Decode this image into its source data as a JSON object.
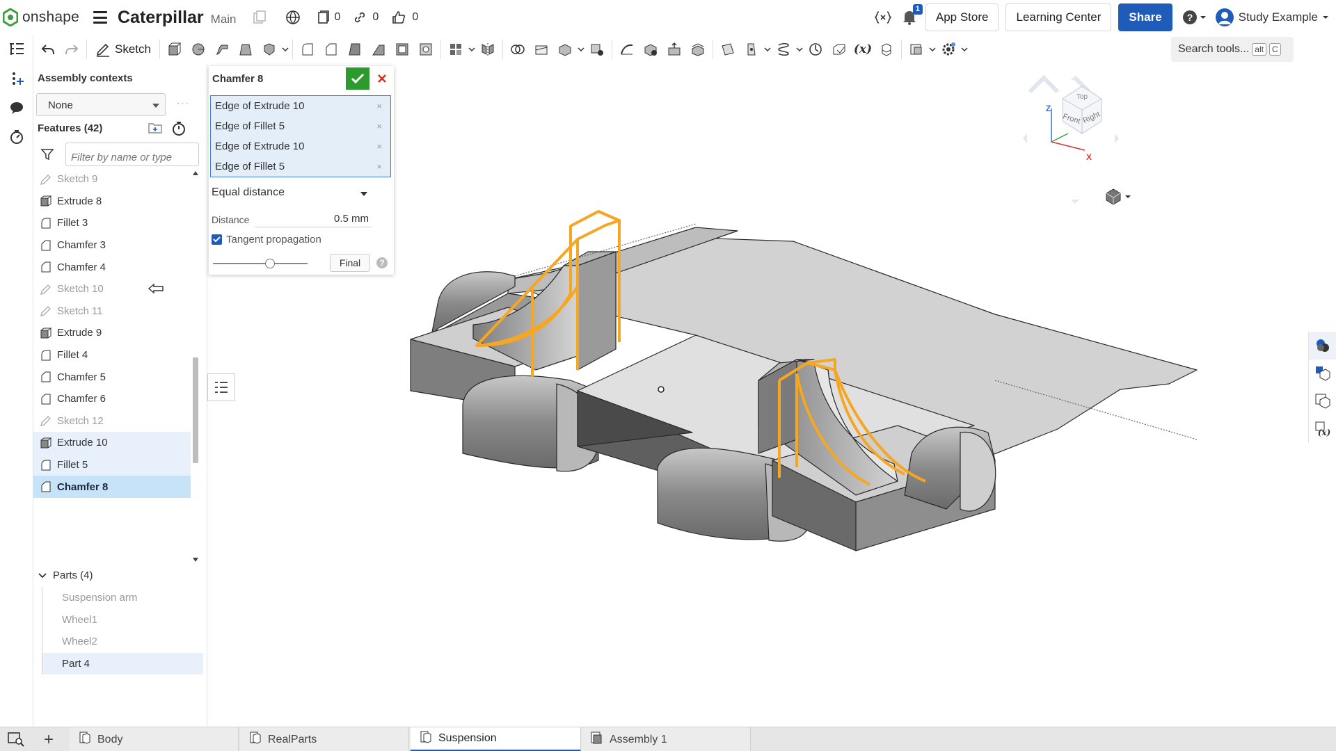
{
  "app": {
    "logo_text": "onshape",
    "doc_title": "Caterpillar",
    "branch": "Main",
    "versions_count": "0",
    "links_count": "0",
    "likes_count": "0",
    "notifications_count": "1",
    "app_store_label": "App Store",
    "learning_center_label": "Learning Center",
    "share_label": "Share",
    "user_name": "Study Example",
    "brand_color": "#1f5bb8",
    "accent_color": "#f5a623"
  },
  "toolbar": {
    "sketch_label": "Sketch",
    "search_placeholder": "Search tools...",
    "search_shortcut_1": "alt",
    "search_shortcut_2": "C"
  },
  "feature_panel": {
    "assembly_contexts_label": "Assembly contexts",
    "assembly_context_value": "None",
    "more_label": "···",
    "features_label": "Features (42)",
    "filter_placeholder": "Filter by name or type",
    "features": [
      {
        "name": "Sketch 9",
        "type": "sketch",
        "state": "muted"
      },
      {
        "name": "Extrude 8",
        "type": "extrude",
        "state": "normal"
      },
      {
        "name": "Fillet 3",
        "type": "fillet",
        "state": "normal"
      },
      {
        "name": "Chamfer 3",
        "type": "chamfer",
        "state": "normal"
      },
      {
        "name": "Chamfer 4",
        "type": "chamfer",
        "state": "normal"
      },
      {
        "name": "Sketch 10",
        "type": "sketch",
        "state": "muted"
      },
      {
        "name": "Sketch 11",
        "type": "sketch",
        "state": "muted"
      },
      {
        "name": "Extrude 9",
        "type": "extrude",
        "state": "normal"
      },
      {
        "name": "Fillet 4",
        "type": "fillet",
        "state": "normal"
      },
      {
        "name": "Chamfer 5",
        "type": "chamfer",
        "state": "normal"
      },
      {
        "name": "Chamfer 6",
        "type": "chamfer",
        "state": "normal"
      },
      {
        "name": "Sketch 12",
        "type": "sketch",
        "state": "muted"
      },
      {
        "name": "Extrude 10",
        "type": "extrude",
        "state": "highlighted"
      },
      {
        "name": "Fillet 5",
        "type": "fillet",
        "state": "highlighted"
      },
      {
        "name": "Chamfer 8",
        "type": "chamfer",
        "state": "selected"
      }
    ],
    "parts_label": "Parts (4)",
    "parts": [
      {
        "name": "Suspension arm",
        "state": "muted"
      },
      {
        "name": "Wheel1",
        "state": "muted"
      },
      {
        "name": "Wheel2",
        "state": "muted"
      },
      {
        "name": "Part 4",
        "state": "highlighted"
      }
    ]
  },
  "dialog": {
    "title": "Chamfer 8",
    "selections": [
      {
        "label": "Edge of Extrude 10",
        "remove": "×"
      },
      {
        "label": "Edge of Fillet 5",
        "remove": "×"
      },
      {
        "label": "Edge of Extrude 10",
        "remove": "×"
      },
      {
        "label": "Edge of Fillet 5",
        "remove": "×"
      }
    ],
    "chamfer_type": "Equal distance",
    "distance_label": "Distance",
    "distance_value": "0.5 mm",
    "tangent_label": "Tangent propagation",
    "tangent_checked": true,
    "slider_value": 0.6,
    "final_label": "Final",
    "help_label": "?"
  },
  "view_cube": {
    "top_label": "Top",
    "front_label": "Front",
    "right_label": "Right",
    "z_label": "Z",
    "x_label": "X"
  },
  "tabs": [
    {
      "label": "Body",
      "icon": "part-studio-icon",
      "active": false
    },
    {
      "label": "RealParts",
      "icon": "part-studio-icon",
      "active": false
    },
    {
      "label": "Suspension",
      "icon": "part-studio-icon",
      "active": true
    },
    {
      "label": "Assembly 1",
      "icon": "assembly-icon",
      "active": false
    }
  ]
}
